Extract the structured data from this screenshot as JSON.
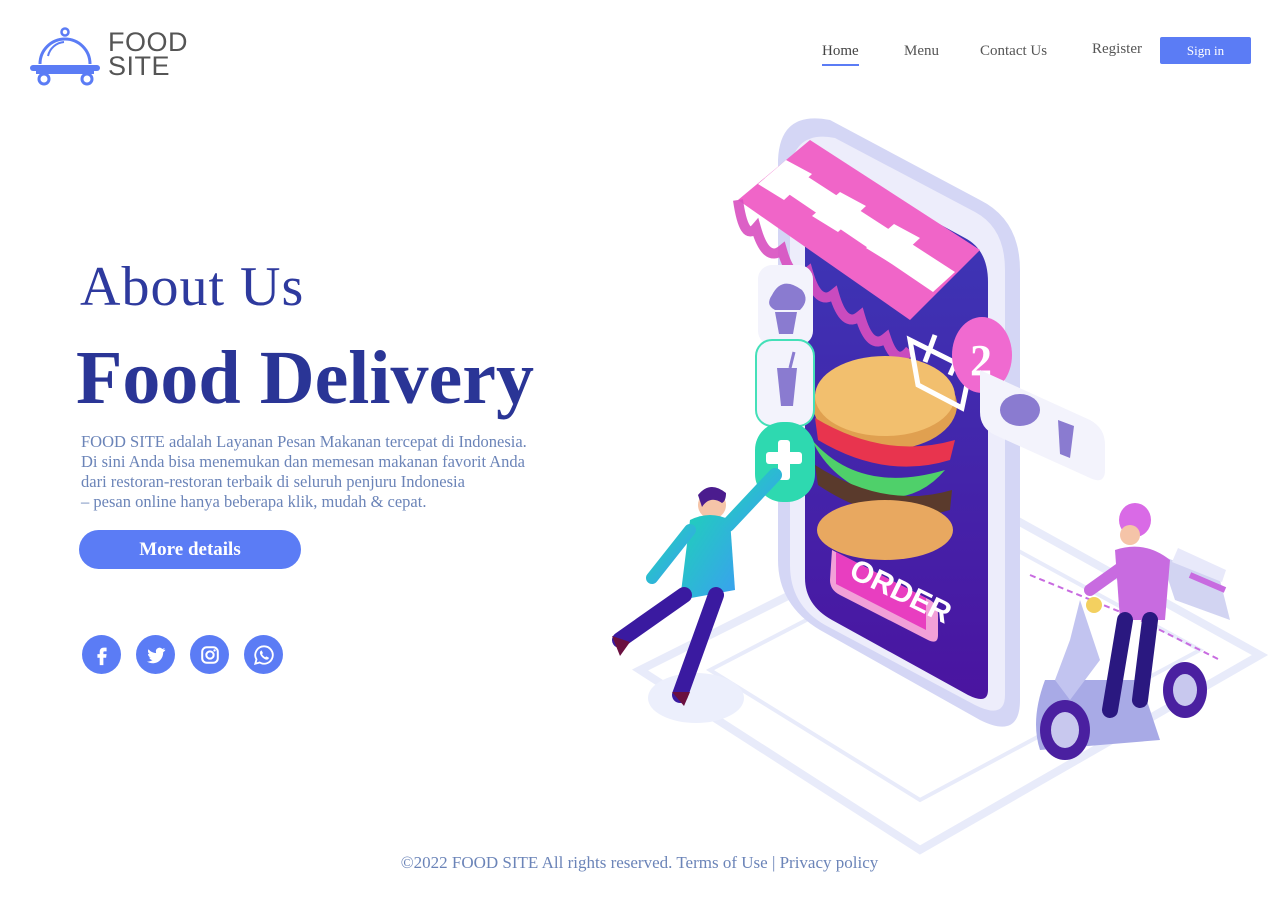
{
  "brand": {
    "line1": "FOOD",
    "line2": "SITE",
    "accent": "#5b7cf5",
    "dark": "#2a3596"
  },
  "nav": {
    "home": "Home",
    "menu": "Menu",
    "contact": "Contact Us",
    "register": "Register",
    "signin": "Sign in"
  },
  "hero": {
    "about": "About Us",
    "headline": "Food Delivery",
    "desc_lines": [
      "FOOD SITE adalah Layanan Pesan Makanan tercepat di Indonesia.",
      "Di sini Anda bisa menemukan dan memesan makanan favorit Anda",
      "dari restoran-restoran terbaik di seluruh penjuru Indonesia",
      " – pesan online hanya beberapa klik, mudah & cepat."
    ],
    "button": "More details"
  },
  "socials": [
    "facebook-icon",
    "twitter-icon",
    "instagram-icon",
    "whatsapp-icon"
  ],
  "illustration": {
    "order_label": "ORDER",
    "cart_count": "2"
  },
  "footer": {
    "copyright": "©2022 FOOD SITE All rights reserved.",
    "terms": "Terms of Use",
    "separator": "|",
    "privacy": "Privacy policy"
  }
}
